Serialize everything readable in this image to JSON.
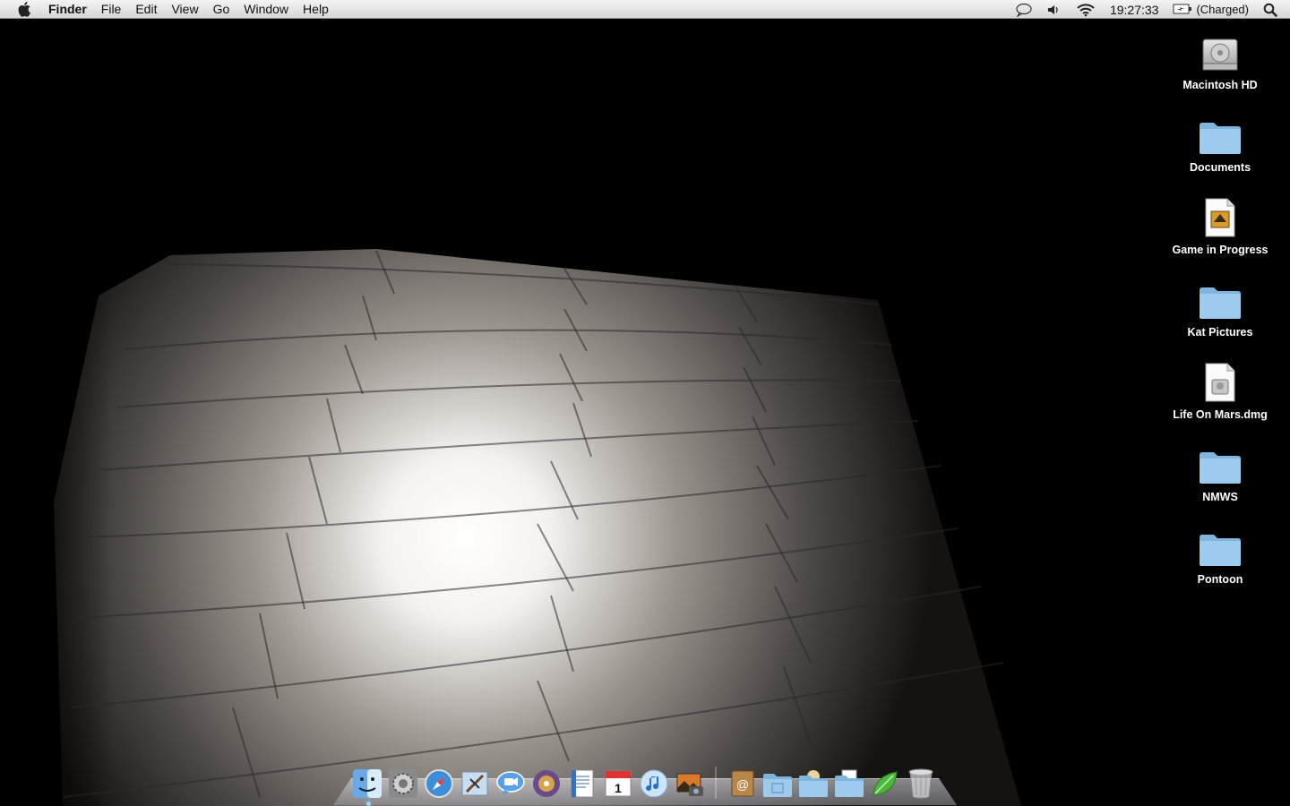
{
  "menubar": {
    "apple_icon": "apple-icon",
    "app_name": "Finder",
    "menus": [
      "File",
      "Edit",
      "View",
      "Go",
      "Window",
      "Help"
    ],
    "extras": {
      "speech_icon": "speech-bubble-icon",
      "volume_icon": "speaker-icon",
      "wifi_icon": "wifi-icon",
      "clock": "19:27:33",
      "battery_icon": "battery-charging-icon",
      "battery_label": "(Charged)",
      "spotlight_icon": "magnifier-icon"
    }
  },
  "desktop": {
    "icons": [
      {
        "label": "Macintosh HD",
        "icon": "hard-drive-icon"
      },
      {
        "label": "Documents",
        "icon": "folder-icon"
      },
      {
        "label": "Game in Progress",
        "icon": "document-icon"
      },
      {
        "label": "Kat Pictures",
        "icon": "folder-icon"
      },
      {
        "label": "Life On Mars.dmg",
        "icon": "disk-image-icon"
      },
      {
        "label": "NMWS",
        "icon": "folder-icon"
      },
      {
        "label": "Pontoon",
        "icon": "folder-icon"
      }
    ]
  },
  "dock": {
    "apps": [
      "finder-icon",
      "system-preferences-icon",
      "safari-icon",
      "mail-icon",
      "ichat-icon",
      "itunes-radio-icon",
      "textedit-icon",
      "ical-icon",
      "itunes-icon",
      "iphoto-icon"
    ],
    "others": [
      "address-book-icon",
      "applications-folder-icon",
      "documents-folder-icon",
      "downloads-folder-icon",
      "growl-icon",
      "trash-icon"
    ]
  },
  "colors": {
    "folder_blue": "#8ec3e8",
    "menubar_bg": "#e4e4e4"
  }
}
